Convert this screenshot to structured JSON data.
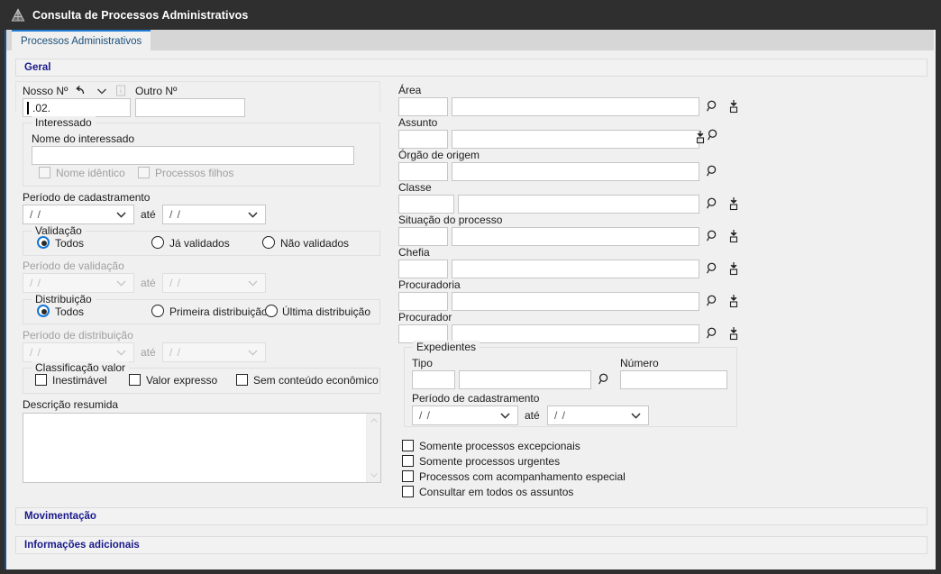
{
  "window": {
    "title": "Consulta de Processos Administrativos",
    "icon": "pyramid-icon",
    "titlebar_color": "#2f2f2f",
    "accent_color": "#1e7ad4",
    "section_text_color": "#1a1a8c"
  },
  "tabs": [
    {
      "label": "Processos Administrativos",
      "active": true
    }
  ],
  "sections": [
    {
      "id": "geral",
      "label": "Geral",
      "expanded": true
    },
    {
      "id": "movimentacao",
      "label": "Movimentação",
      "expanded": false
    },
    {
      "id": "informacoes",
      "label": "Informações adicionais",
      "expanded": false
    }
  ],
  "left": {
    "nosso_numero": {
      "label": "Nosso Nº",
      "value": ".02.",
      "placeholder": "",
      "undo_icon": "undo-arrow-icon",
      "chevron_icon": "chevron-down-icon",
      "info_icon": "info-icon"
    },
    "outro_numero": {
      "label": "Outro Nº",
      "value": "",
      "placeholder": ""
    },
    "interessado": {
      "legend": "Interessado",
      "nome_label": "Nome do interessado",
      "nome_value": "",
      "checkboxes": [
        {
          "label": "Nome idêntico",
          "checked": false,
          "disabled": true
        },
        {
          "label": "Processos filhos",
          "checked": false,
          "disabled": true
        }
      ]
    },
    "periodo_cadastramento": {
      "label": "Período de cadastramento",
      "from": "/ /",
      "until_label": "até",
      "to": "/ /",
      "disabled": false
    },
    "validacao": {
      "legend": "Validação",
      "options": [
        {
          "label": "Todos",
          "selected": true
        },
        {
          "label": "Já validados",
          "selected": false
        },
        {
          "label": "Não validados",
          "selected": false
        }
      ]
    },
    "periodo_validacao": {
      "label": "Período de validação",
      "from": "/ /",
      "until_label": "até",
      "to": "/ /",
      "disabled": true
    },
    "distribuicao": {
      "legend": "Distribuição",
      "options": [
        {
          "label": "Todos",
          "selected": true
        },
        {
          "label": "Primeira distribuição",
          "selected": false
        },
        {
          "label": "Última distribuição",
          "selected": false
        }
      ]
    },
    "periodo_distribuicao": {
      "label": "Período de distribuição",
      "from": "/ /",
      "until_label": "até",
      "to": "/ /",
      "disabled": true
    },
    "classificacao_valor": {
      "legend": "Classificação valor",
      "checkboxes": [
        {
          "label": "Inestimável",
          "checked": false
        },
        {
          "label": "Valor expresso",
          "checked": false
        },
        {
          "label": "Sem conteúdo econômico",
          "checked": false
        }
      ]
    },
    "descricao_resumida": {
      "label": "Descrição resumida",
      "value": "",
      "placeholder": ""
    }
  },
  "right": {
    "lookups": [
      {
        "label": "Área",
        "code": "",
        "value": "",
        "icons": [
          "search-icon",
          "drop-into-box-icon"
        ],
        "icon_order": "search-first"
      },
      {
        "label": "Assunto",
        "code": "",
        "value": "",
        "icons": [
          "drop-into-box-icon",
          "search-icon"
        ],
        "icon_order": "box-first"
      },
      {
        "label": "Órgão de origem",
        "code": "",
        "value": "",
        "icons": [
          "search-icon"
        ],
        "icon_order": "search-first"
      },
      {
        "label": "Classe",
        "code": "",
        "value": "",
        "icons": [
          "search-icon",
          "drop-into-box-icon"
        ],
        "icon_order": "search-first"
      },
      {
        "label": "Situação do processo",
        "code": "",
        "value": "",
        "icons": [
          "search-icon",
          "drop-into-box-icon"
        ],
        "icon_order": "search-first"
      },
      {
        "label": "Chefia",
        "code": "",
        "value": "",
        "icons": [
          "search-icon",
          "drop-into-box-icon"
        ],
        "icon_order": "search-first"
      },
      {
        "label": "Procuradoria",
        "code": "",
        "value": "",
        "icons": [
          "search-icon",
          "drop-into-box-icon"
        ],
        "icon_order": "search-first"
      },
      {
        "label": "Procurador",
        "code": "",
        "value": "",
        "icons": [
          "search-icon",
          "drop-into-box-icon"
        ],
        "icon_order": "search-first"
      }
    ],
    "expedientes": {
      "legend": "Expedientes",
      "tipo_label": "Tipo",
      "tipo_code": "",
      "tipo_value": "",
      "tipo_search_icon": "search-icon",
      "numero_label": "Número",
      "numero_value": "",
      "periodo_label": "Período de cadastramento",
      "periodo_from": "/ /",
      "periodo_until_label": "até",
      "periodo_to": "/ /"
    },
    "checkboxes": [
      {
        "label": "Somente processos excepcionais",
        "checked": false
      },
      {
        "label": "Somente processos urgentes",
        "checked": false
      },
      {
        "label": "Processos com acompanhamento especial",
        "checked": false
      },
      {
        "label": "Consultar em todos os assuntos",
        "checked": false
      }
    ]
  }
}
